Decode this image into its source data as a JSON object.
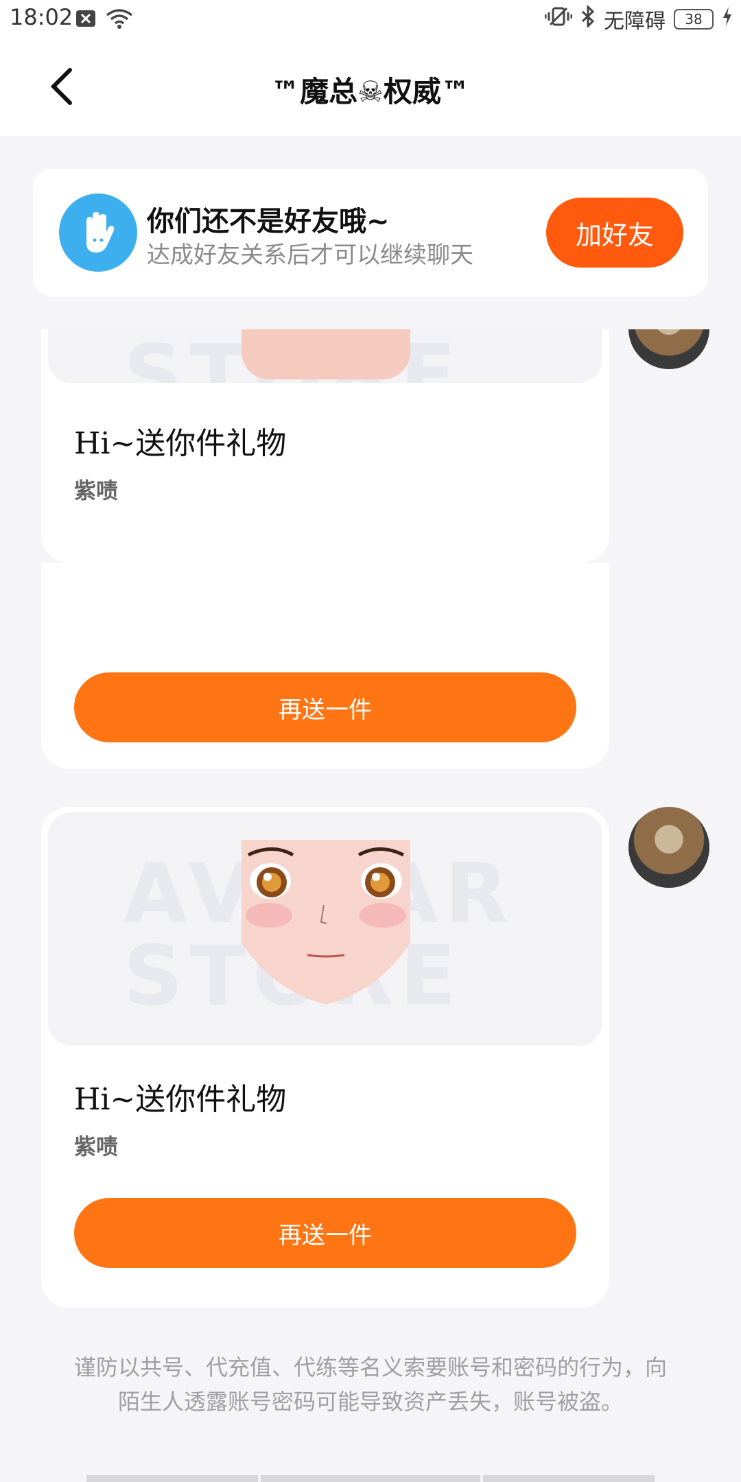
{
  "status_bar": {
    "time": "18:02",
    "accessibility_label": "无障碍",
    "battery": "38"
  },
  "header": {
    "title": "™魔总☠权威™"
  },
  "friend_banner": {
    "title": "你们还不是好友哦~",
    "subtitle": "达成好友关系后才可以继续聊天",
    "add_button": "加好友"
  },
  "messages": [
    {
      "title": "Hi~送你件礼物",
      "item": "紫啧",
      "button": "再送一件",
      "watermark": "AVATAR STORE"
    },
    {
      "title": "Hi~送你件礼物",
      "item": "紫啧",
      "button": "再送一件",
      "watermark": "AVATAR STORE"
    }
  ],
  "disclaimer": "谨防以共号、代充值、代练等名义索要账号和密码的行为，向陌生人透露账号密码可能导致资产丢失，账号被盗。",
  "colors": {
    "accent": "#ff7514",
    "add_friend": "#ff5a0e",
    "avatar_blue": "#3dafef"
  }
}
